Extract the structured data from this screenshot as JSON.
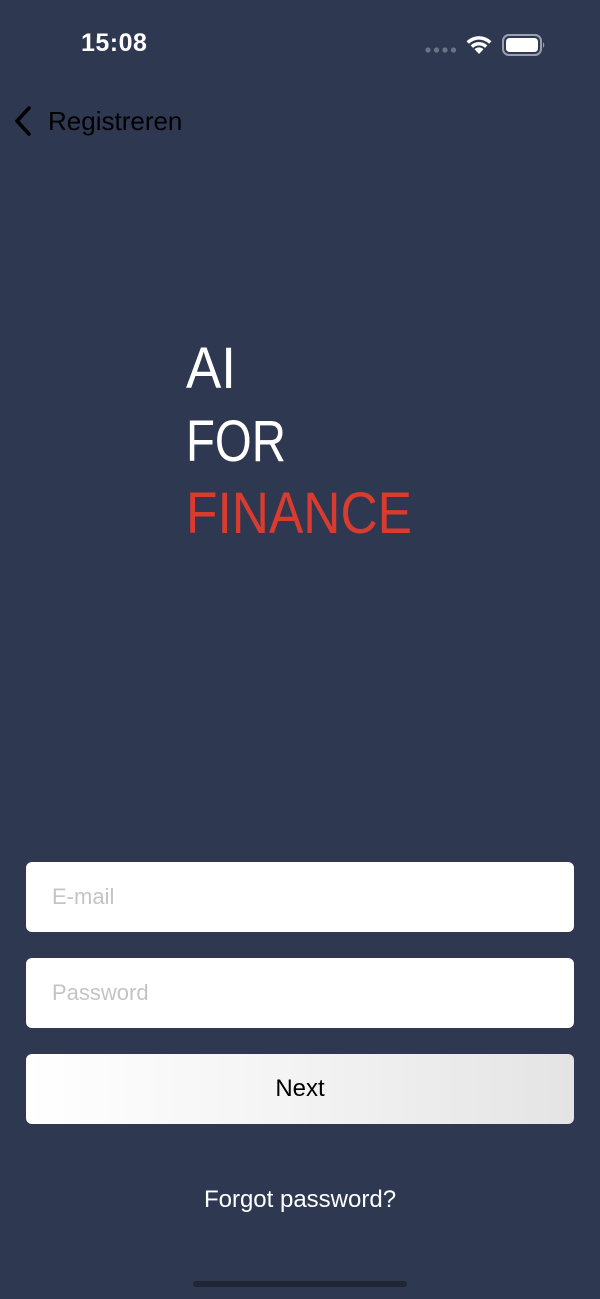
{
  "status_bar": {
    "time": "15:08",
    "icons": [
      "signal-dots-icon",
      "wifi-icon",
      "battery-icon"
    ]
  },
  "nav": {
    "back_label": "Registreren",
    "back_icon": "chevron-left-icon"
  },
  "logo": {
    "line1": "AI",
    "line2": "FOR",
    "line3": "FINANCE",
    "colors": {
      "primary": "#ffffff",
      "accent": "#d93b2e"
    }
  },
  "form": {
    "email_placeholder": "E-mail",
    "email_value": "",
    "password_placeholder": "Password",
    "password_value": "",
    "next_label": "Next",
    "forgot_label": "Forgot password?"
  },
  "colors": {
    "background": "#2e3851",
    "field": "#ffffff",
    "accent": "#d93b2e"
  }
}
